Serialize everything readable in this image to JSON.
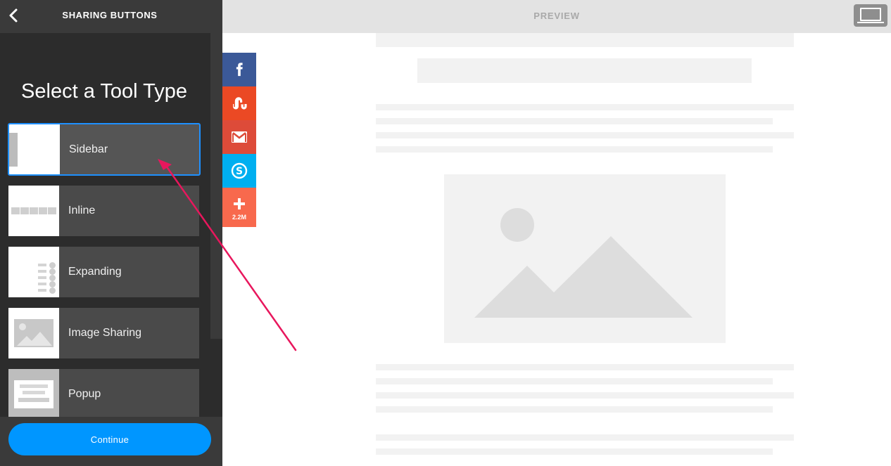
{
  "header": {
    "title": "SHARING BUTTONS",
    "back_icon": "chevron-left-icon"
  },
  "panel": {
    "heading": "Select a Tool Type"
  },
  "tools": [
    {
      "label": "Sidebar",
      "selected": true
    },
    {
      "label": "Inline",
      "selected": false
    },
    {
      "label": "Expanding",
      "selected": false
    },
    {
      "label": "Image Sharing",
      "selected": false
    },
    {
      "label": "Popup",
      "selected": false
    }
  ],
  "footer": {
    "continue_label": "Continue"
  },
  "preview": {
    "label": "PREVIEW",
    "device_icon": "desktop-icon"
  },
  "share_bar": {
    "buttons": [
      {
        "name": "facebook",
        "color": "#3b5998"
      },
      {
        "name": "stumbleupon",
        "color": "#eb4924"
      },
      {
        "name": "gmail",
        "color": "#dd4b39"
      },
      {
        "name": "skype",
        "color": "#00aff0"
      },
      {
        "name": "more",
        "color": "#f8694d",
        "count": "2.2M"
      }
    ]
  },
  "colors": {
    "accent": "#0096ff",
    "selected_border": "#1e90ff",
    "annotation_arrow": "#e8175d"
  }
}
